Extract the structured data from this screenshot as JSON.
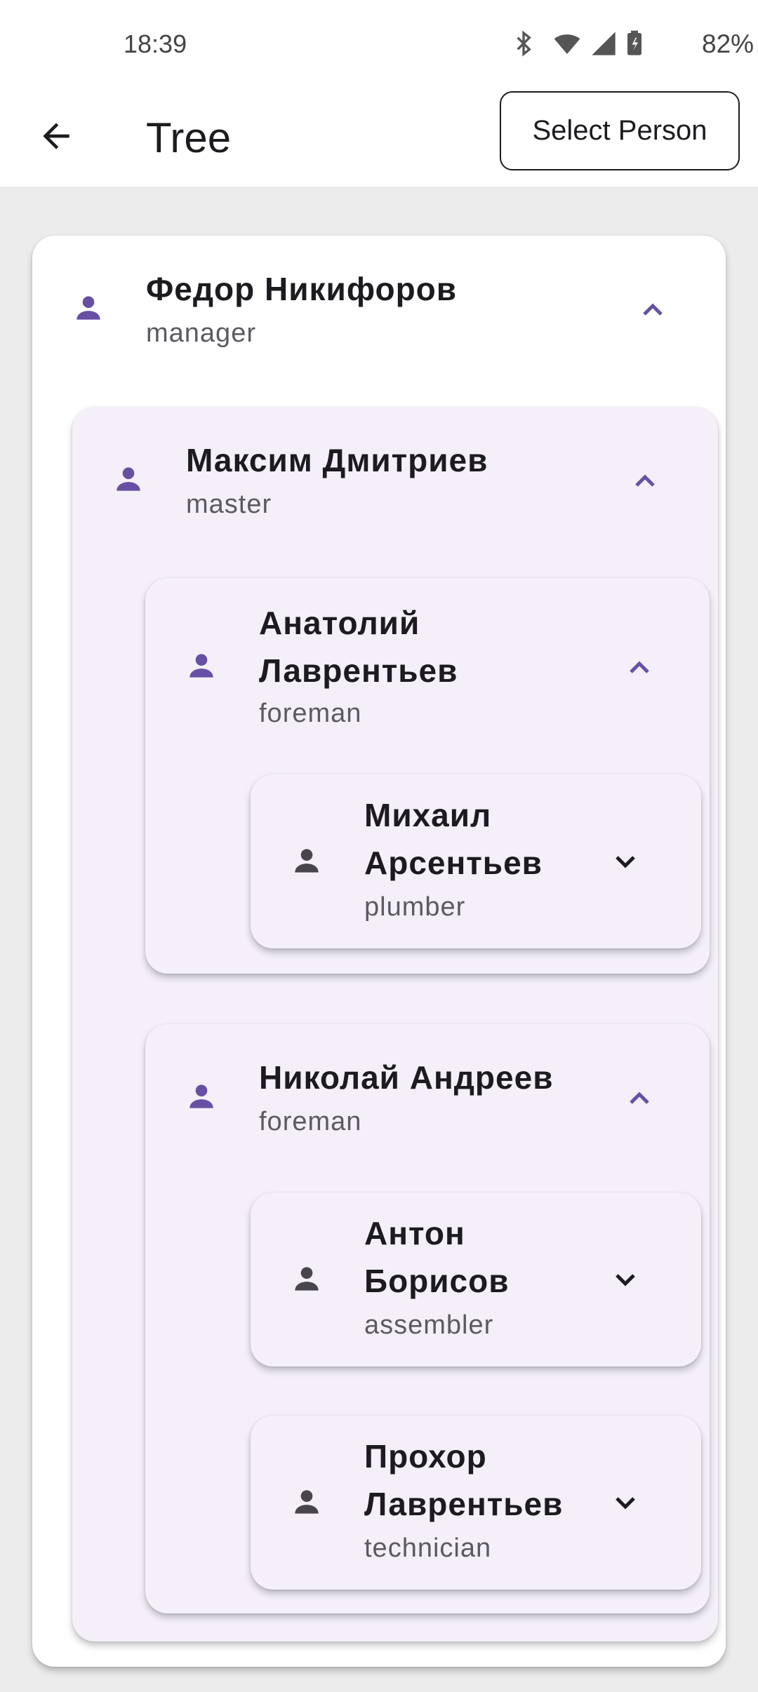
{
  "status_bar": {
    "time": "18:39",
    "battery": "82%"
  },
  "app_bar": {
    "title": "Tree",
    "select_button": "Select Person"
  },
  "colors": {
    "accent": "#6750a4",
    "leaf_icon": "#49454f",
    "card_tint": "#f4eff8"
  },
  "tree": {
    "root": {
      "name": "Федор  Никифоров",
      "role": "manager",
      "icon": "person-icon",
      "expanded": true
    },
    "master": {
      "name": "Максим Дмитриев",
      "role": "master",
      "icon": "person-icon",
      "expanded": true
    },
    "foreman1": {
      "name_line1": "Анатолий",
      "name_line2": "Лаврентьев",
      "role": "foreman",
      "icon": "person-icon",
      "expanded": true
    },
    "worker1": {
      "name_line1": "Михаил",
      "name_line2": "Арсентьев",
      "role": "plumber",
      "icon": "person-icon",
      "expanded": false
    },
    "foreman2": {
      "name": "Николай Андреев",
      "role": "foreman",
      "icon": "person-icon",
      "expanded": true
    },
    "worker2": {
      "name_line1": "Антон",
      "name_line2": "Борисов",
      "role": "assembler",
      "icon": "person-icon",
      "expanded": false
    },
    "worker3": {
      "name_line1": "Прохор",
      "name_line2": "Лаврентьев",
      "role": "technician",
      "icon": "person-icon",
      "expanded": false
    }
  }
}
